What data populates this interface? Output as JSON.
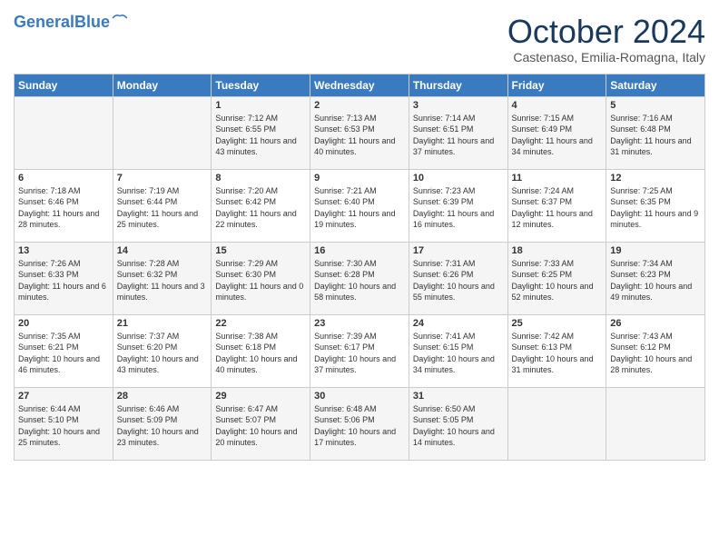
{
  "header": {
    "logo_line1": "General",
    "logo_line2": "Blue",
    "month_title": "October 2024",
    "location": "Castenaso, Emilia-Romagna, Italy"
  },
  "days_of_week": [
    "Sunday",
    "Monday",
    "Tuesday",
    "Wednesday",
    "Thursday",
    "Friday",
    "Saturday"
  ],
  "weeks": [
    [
      {
        "day": "",
        "content": ""
      },
      {
        "day": "",
        "content": ""
      },
      {
        "day": "1",
        "content": "Sunrise: 7:12 AM\nSunset: 6:55 PM\nDaylight: 11 hours and 43 minutes."
      },
      {
        "day": "2",
        "content": "Sunrise: 7:13 AM\nSunset: 6:53 PM\nDaylight: 11 hours and 40 minutes."
      },
      {
        "day": "3",
        "content": "Sunrise: 7:14 AM\nSunset: 6:51 PM\nDaylight: 11 hours and 37 minutes."
      },
      {
        "day": "4",
        "content": "Sunrise: 7:15 AM\nSunset: 6:49 PM\nDaylight: 11 hours and 34 minutes."
      },
      {
        "day": "5",
        "content": "Sunrise: 7:16 AM\nSunset: 6:48 PM\nDaylight: 11 hours and 31 minutes."
      }
    ],
    [
      {
        "day": "6",
        "content": "Sunrise: 7:18 AM\nSunset: 6:46 PM\nDaylight: 11 hours and 28 minutes."
      },
      {
        "day": "7",
        "content": "Sunrise: 7:19 AM\nSunset: 6:44 PM\nDaylight: 11 hours and 25 minutes."
      },
      {
        "day": "8",
        "content": "Sunrise: 7:20 AM\nSunset: 6:42 PM\nDaylight: 11 hours and 22 minutes."
      },
      {
        "day": "9",
        "content": "Sunrise: 7:21 AM\nSunset: 6:40 PM\nDaylight: 11 hours and 19 minutes."
      },
      {
        "day": "10",
        "content": "Sunrise: 7:23 AM\nSunset: 6:39 PM\nDaylight: 11 hours and 16 minutes."
      },
      {
        "day": "11",
        "content": "Sunrise: 7:24 AM\nSunset: 6:37 PM\nDaylight: 11 hours and 12 minutes."
      },
      {
        "day": "12",
        "content": "Sunrise: 7:25 AM\nSunset: 6:35 PM\nDaylight: 11 hours and 9 minutes."
      }
    ],
    [
      {
        "day": "13",
        "content": "Sunrise: 7:26 AM\nSunset: 6:33 PM\nDaylight: 11 hours and 6 minutes."
      },
      {
        "day": "14",
        "content": "Sunrise: 7:28 AM\nSunset: 6:32 PM\nDaylight: 11 hours and 3 minutes."
      },
      {
        "day": "15",
        "content": "Sunrise: 7:29 AM\nSunset: 6:30 PM\nDaylight: 11 hours and 0 minutes."
      },
      {
        "day": "16",
        "content": "Sunrise: 7:30 AM\nSunset: 6:28 PM\nDaylight: 10 hours and 58 minutes."
      },
      {
        "day": "17",
        "content": "Sunrise: 7:31 AM\nSunset: 6:26 PM\nDaylight: 10 hours and 55 minutes."
      },
      {
        "day": "18",
        "content": "Sunrise: 7:33 AM\nSunset: 6:25 PM\nDaylight: 10 hours and 52 minutes."
      },
      {
        "day": "19",
        "content": "Sunrise: 7:34 AM\nSunset: 6:23 PM\nDaylight: 10 hours and 49 minutes."
      }
    ],
    [
      {
        "day": "20",
        "content": "Sunrise: 7:35 AM\nSunset: 6:21 PM\nDaylight: 10 hours and 46 minutes."
      },
      {
        "day": "21",
        "content": "Sunrise: 7:37 AM\nSunset: 6:20 PM\nDaylight: 10 hours and 43 minutes."
      },
      {
        "day": "22",
        "content": "Sunrise: 7:38 AM\nSunset: 6:18 PM\nDaylight: 10 hours and 40 minutes."
      },
      {
        "day": "23",
        "content": "Sunrise: 7:39 AM\nSunset: 6:17 PM\nDaylight: 10 hours and 37 minutes."
      },
      {
        "day": "24",
        "content": "Sunrise: 7:41 AM\nSunset: 6:15 PM\nDaylight: 10 hours and 34 minutes."
      },
      {
        "day": "25",
        "content": "Sunrise: 7:42 AM\nSunset: 6:13 PM\nDaylight: 10 hours and 31 minutes."
      },
      {
        "day": "26",
        "content": "Sunrise: 7:43 AM\nSunset: 6:12 PM\nDaylight: 10 hours and 28 minutes."
      }
    ],
    [
      {
        "day": "27",
        "content": "Sunrise: 6:44 AM\nSunset: 5:10 PM\nDaylight: 10 hours and 25 minutes."
      },
      {
        "day": "28",
        "content": "Sunrise: 6:46 AM\nSunset: 5:09 PM\nDaylight: 10 hours and 23 minutes."
      },
      {
        "day": "29",
        "content": "Sunrise: 6:47 AM\nSunset: 5:07 PM\nDaylight: 10 hours and 20 minutes."
      },
      {
        "day": "30",
        "content": "Sunrise: 6:48 AM\nSunset: 5:06 PM\nDaylight: 10 hours and 17 minutes."
      },
      {
        "day": "31",
        "content": "Sunrise: 6:50 AM\nSunset: 5:05 PM\nDaylight: 10 hours and 14 minutes."
      },
      {
        "day": "",
        "content": ""
      },
      {
        "day": "",
        "content": ""
      }
    ]
  ]
}
